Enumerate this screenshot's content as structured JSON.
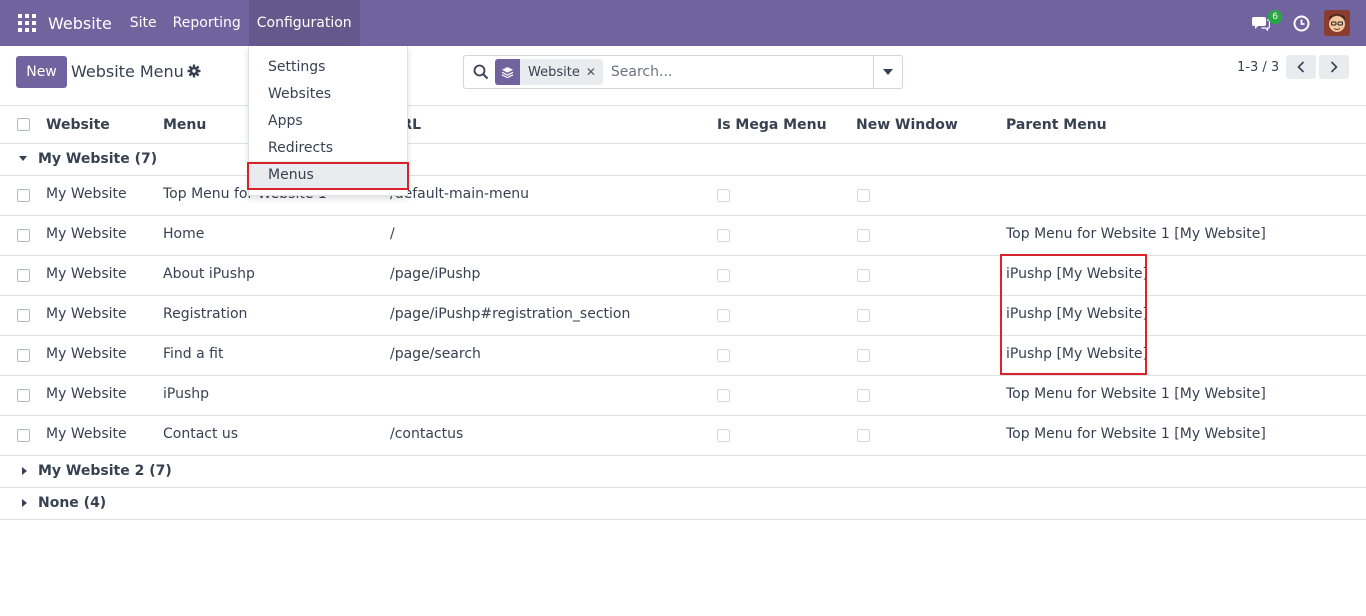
{
  "topnav": {
    "brand": "Website",
    "menu": [
      "Site",
      "Reporting",
      "Configuration"
    ],
    "active_menu": "Configuration",
    "chat_count": "6",
    "brand_color": "#71639e"
  },
  "control_panel": {
    "new_label": "New",
    "breadcrumb": "Website Menu",
    "search": {
      "facet_label": "Website",
      "placeholder": "Search..."
    },
    "pager": "1-3 / 3"
  },
  "table": {
    "columns": [
      "Website",
      "Menu",
      "URL",
      "Is Mega Menu",
      "New Window",
      "Parent Menu"
    ],
    "groups": [
      {
        "label": "My Website (7)",
        "expanded": true
      },
      {
        "label": "My Website 2 (7)",
        "expanded": false
      },
      {
        "label": "None (4)",
        "expanded": false
      }
    ],
    "rows": [
      {
        "website": "My Website",
        "menu": "Top Menu for Website 1",
        "url": "/default-main-menu",
        "parent": ""
      },
      {
        "website": "My Website",
        "menu": "Home",
        "url": "/",
        "parent": "Top Menu for Website 1 [My Website]"
      },
      {
        "website": "My Website",
        "menu": "About iPushp",
        "url": "/page/iPushp",
        "parent": "iPushp [My Website]"
      },
      {
        "website": "My Website",
        "menu": "Registration",
        "url": "/page/iPushp#registration_section",
        "parent": "iPushp [My Website]"
      },
      {
        "website": "My Website",
        "menu": "Find a fit",
        "url": "/page/search",
        "parent": "iPushp [My Website]"
      },
      {
        "website": "My Website",
        "menu": "iPushp",
        "url": "",
        "parent": "Top Menu for Website 1 [My Website]"
      },
      {
        "website": "My Website",
        "menu": "Contact us",
        "url": "/contactus",
        "parent": "Top Menu for Website 1 [My Website]"
      }
    ]
  },
  "config_dropdown": {
    "items": [
      "Settings",
      "Websites",
      "Apps",
      "Redirects",
      "Menus"
    ],
    "highlighted": "Menus"
  },
  "highlight_color": "#d9232a"
}
